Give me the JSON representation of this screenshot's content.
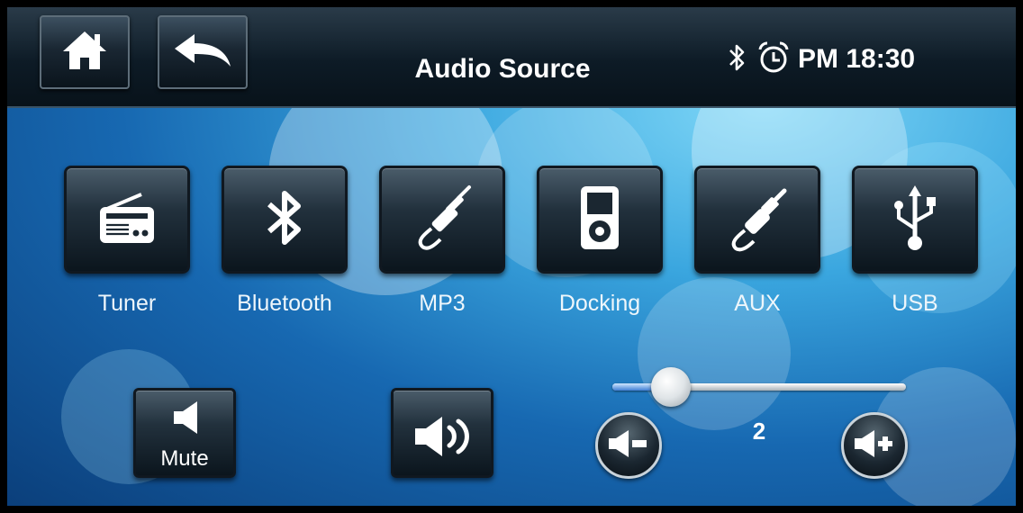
{
  "header": {
    "title": "Audio Source",
    "home_icon": "home-icon",
    "back_icon": "back-arrow-icon",
    "bluetooth_icon": "bluetooth-icon",
    "alarm_icon": "alarm-clock-icon",
    "clock": "PM 18:30"
  },
  "sources": [
    {
      "label": "Tuner",
      "icon": "radio-icon"
    },
    {
      "label": "Bluetooth",
      "icon": "bluetooth-icon"
    },
    {
      "label": "MP3",
      "icon": "audio-jack-icon"
    },
    {
      "label": "Docking",
      "icon": "ipod-icon"
    },
    {
      "label": "AUX",
      "icon": "rca-cable-icon"
    },
    {
      "label": "USB",
      "icon": "usb-icon"
    }
  ],
  "controls": {
    "mute_label": "Mute",
    "mute_icon": "speaker-mute-icon",
    "speaker_icon": "speaker-on-icon",
    "volume_down_icon": "volume-down-icon",
    "volume_up_icon": "volume-up-icon",
    "volume_value": "2",
    "volume_fraction": 0.2
  },
  "colors": {
    "background": "#1768b1",
    "topbar": "#0d1b26",
    "text": "#ffffff"
  }
}
